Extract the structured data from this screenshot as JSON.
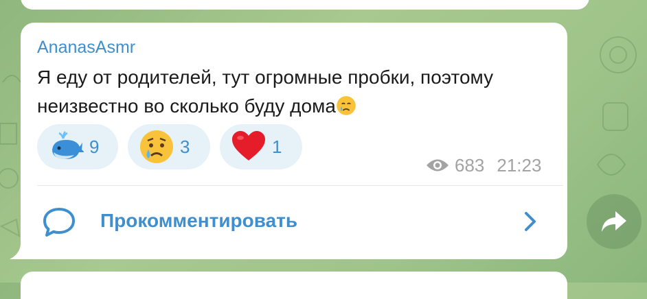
{
  "message": {
    "author": "AnanasAsmr",
    "text": "Я еду от родителей, тут огромные пробки, поэтому неизвестно во сколько буду дома",
    "inline_emoji": "crying-face-icon"
  },
  "reactions": [
    {
      "emoji": "whale-icon",
      "count": "9"
    },
    {
      "emoji": "crying-face-icon",
      "count": "3"
    },
    {
      "emoji": "heart-icon",
      "count": "1"
    }
  ],
  "meta": {
    "views": "683",
    "time": "21:23"
  },
  "comment": {
    "label": "Прокомментировать"
  },
  "colors": {
    "accent": "#3f8fce",
    "reaction_bg": "#e6f1f8",
    "meta": "#a3a3a3",
    "background": "#9fc48a"
  }
}
